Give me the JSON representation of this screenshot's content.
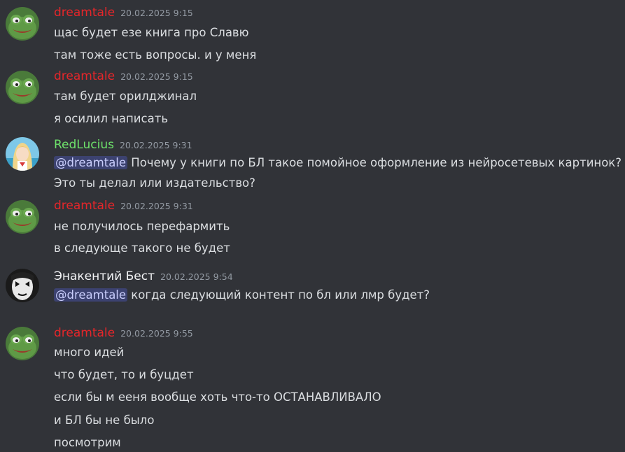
{
  "colors": {
    "background": "#313338",
    "dreamtale": "#e6262a",
    "redlucius": "#6ee26b",
    "enakentiy": "#f2f3f5",
    "mention_bg": "#3c4270",
    "mention_text": "#c9cdfb",
    "timestamp": "#949ba4",
    "text": "#dbdee1"
  },
  "messages": [
    {
      "author": "dreamtale",
      "avatar": "frog-avatar",
      "timestamp": "20.02.2025 9:15",
      "lines": [
        "щас будет езе книга про Славю",
        "там тоже есть вопросы. и у меня"
      ]
    },
    {
      "author": "dreamtale",
      "avatar": "frog-avatar",
      "timestamp": "20.02.2025 9:15",
      "lines": [
        "там будет орилджинал",
        "я осилил написать"
      ]
    },
    {
      "author": "RedLucius",
      "avatar": "anime-girl-avatar",
      "timestamp": "20.02.2025 9:31",
      "mention": "@dreamtale",
      "lines": [
        " Почему у книги по БЛ такое помойное оформление из нейросетевых картинок?",
        "Это ты делал или издательство?"
      ]
    },
    {
      "author": "dreamtale",
      "avatar": "frog-avatar",
      "timestamp": "20.02.2025 9:31",
      "lines": [
        "не получилось перефармить",
        "в следующе такого не будет"
      ]
    },
    {
      "author": "Энакентий Бест",
      "avatar": "clown-face-avatar",
      "timestamp": "20.02.2025 9:54",
      "mention": "@dreamtale",
      "lines": [
        " когда следующий контент по бл или лмр будет?"
      ]
    },
    {
      "author": "dreamtale",
      "avatar": "frog-avatar",
      "timestamp": "20.02.2025 9:55",
      "lines": [
        "много идей",
        "что будет, то и буцдет",
        "если бы м ееня вообще хоть что-то ОСТАНАВЛИВАЛО",
        "и БЛ бы не было",
        "посмотрим"
      ]
    }
  ]
}
